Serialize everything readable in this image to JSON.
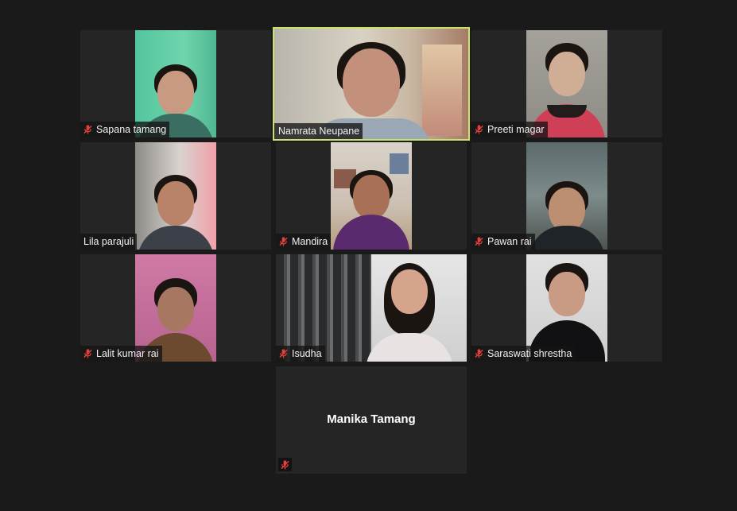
{
  "participants": [
    {
      "name": "Sapana tamang",
      "muted": true
    },
    {
      "name": "Namrata Neupane",
      "muted": false,
      "active_speaker": true
    },
    {
      "name": "Preeti magar",
      "muted": true
    },
    {
      "name": "Lila parajuli",
      "muted": false
    },
    {
      "name": "Mandira",
      "muted": true
    },
    {
      "name": "Pawan rai",
      "muted": true
    },
    {
      "name": "Lalit kumar rai",
      "muted": true
    },
    {
      "name": "Isudha",
      "muted": true
    },
    {
      "name": "Saraswati shrestha",
      "muted": true
    },
    {
      "name": "Manika Tamang",
      "muted": true,
      "video_off": true
    }
  ],
  "colors": {
    "background": "#1a1a1a",
    "tile": "#252525",
    "active_speaker_border": "#c9e36a",
    "muted_icon": "#e0413a"
  },
  "icons": {
    "muted": "microphone-muted-icon"
  }
}
